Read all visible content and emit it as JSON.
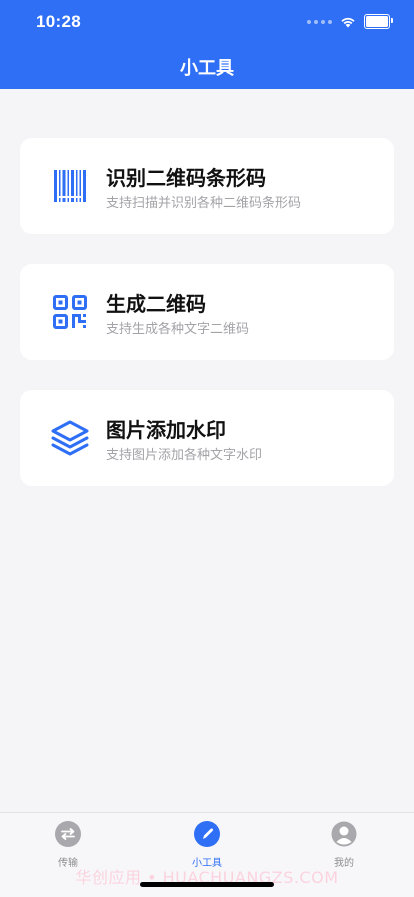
{
  "status_bar": {
    "time": "10:28"
  },
  "header": {
    "title": "小工具"
  },
  "tools": [
    {
      "title": "识别二维码条形码",
      "subtitle": "支持扫描并识别各种二维码条形码",
      "icon": "barcode-icon"
    },
    {
      "title": "生成二维码",
      "subtitle": "支持生成各种文字二维码",
      "icon": "qr-code-icon"
    },
    {
      "title": "图片添加水印",
      "subtitle": "支持图片添加各种文字水印",
      "icon": "layers-icon"
    }
  ],
  "tabbar": {
    "items": [
      {
        "label": "传输",
        "icon": "transfer-icon",
        "active": false
      },
      {
        "label": "小工具",
        "icon": "pen-icon",
        "active": true
      },
      {
        "label": "我的",
        "icon": "user-icon",
        "active": false
      }
    ]
  },
  "watermark": "华创应用 • HUACHUANGZS.COM",
  "colors": {
    "primary": "#2f6ff6",
    "background": "#f5f5f7",
    "card": "#ffffff",
    "subtitle": "#a3a3a8",
    "inactive_tab": "#8e8e93"
  }
}
